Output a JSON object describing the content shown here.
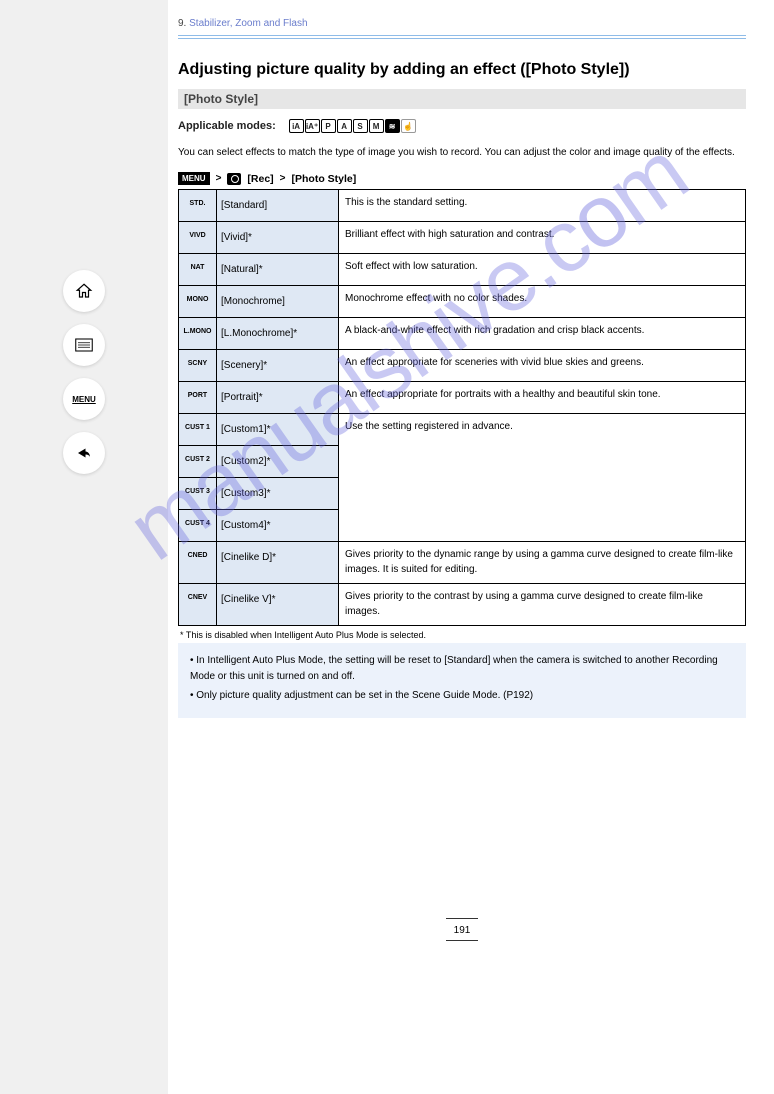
{
  "watermark": "manualshive.com",
  "header": {
    "chapter": "9.",
    "breadcrumb": "Stabilizer, Zoom and Flash"
  },
  "section_title": "Adjusting picture quality by adding an effect ([Photo Style])",
  "bar_label": "[Photo Style]",
  "modes": {
    "prefix": "Applicable modes:",
    "list": [
      "iA",
      "iA+",
      "P",
      "A",
      "S",
      "M",
      "Movie",
      "Custom"
    ]
  },
  "intro": "You can select effects to match the type of image you wish to record. You can adjust the color and image quality of the effects.",
  "menu_path": {
    "badge": "MENU",
    "arrow1": ">",
    "tab": "[Rec]",
    "arrow2": ">",
    "item": "[Photo Style]"
  },
  "rows": [
    {
      "icon": "STD.",
      "name": "[Standard]",
      "desc": "This is the standard setting."
    },
    {
      "icon": "VIVD",
      "name": "[Vivid]*",
      "desc": "Brilliant effect with high saturation and contrast."
    },
    {
      "icon": "NAT",
      "name": "[Natural]*",
      "desc": "Soft effect with low saturation."
    },
    {
      "icon": "MONO",
      "name": "[Monochrome]",
      "desc": "Monochrome effect with no color shades."
    },
    {
      "icon": "L.MONO",
      "name": "[L.Monochrome]*",
      "desc": "A black-and-white effect with rich gradation and crisp black accents."
    },
    {
      "icon": "SCNY",
      "name": "[Scenery]*",
      "desc": "An effect appropriate for sceneries with vivid blue skies and greens."
    },
    {
      "icon": "PORT",
      "name": "[Portrait]*",
      "desc": "An effect appropriate for portraits with a healthy and beautiful skin tone."
    },
    {
      "icon": "CUST 1",
      "name": "[Custom1]*",
      "desc_group_start": true
    },
    {
      "icon": "CUST 2",
      "name": "[Custom2]*"
    },
    {
      "icon": "CUST 3",
      "name": "[Custom3]*"
    },
    {
      "icon": "CUST 4",
      "name": "[Custom4]*"
    }
  ],
  "custom_desc": "Use the setting registered in advance.",
  "cined": {
    "icon": "CNED",
    "name": "[Cinelike D]*",
    "desc": "Gives priority to the dynamic range by using a gamma curve designed to create film-like images. It is suited for editing."
  },
  "cnev": {
    "icon": "CNEV",
    "name": "[Cinelike V]*",
    "desc": "Gives priority to the contrast by using a gamma curve designed to create film-like images."
  },
  "footnote": "* This is disabled when Intelligent Auto Plus Mode is selected.",
  "notes": [
    "In Intelligent Auto Plus Mode, the setting will be reset to [Standard] when the camera is switched to another Recording Mode or this unit is turned on and off.",
    "Only picture quality adjustment can be set in the Scene Guide Mode. (P192)"
  ],
  "page_number": "191"
}
